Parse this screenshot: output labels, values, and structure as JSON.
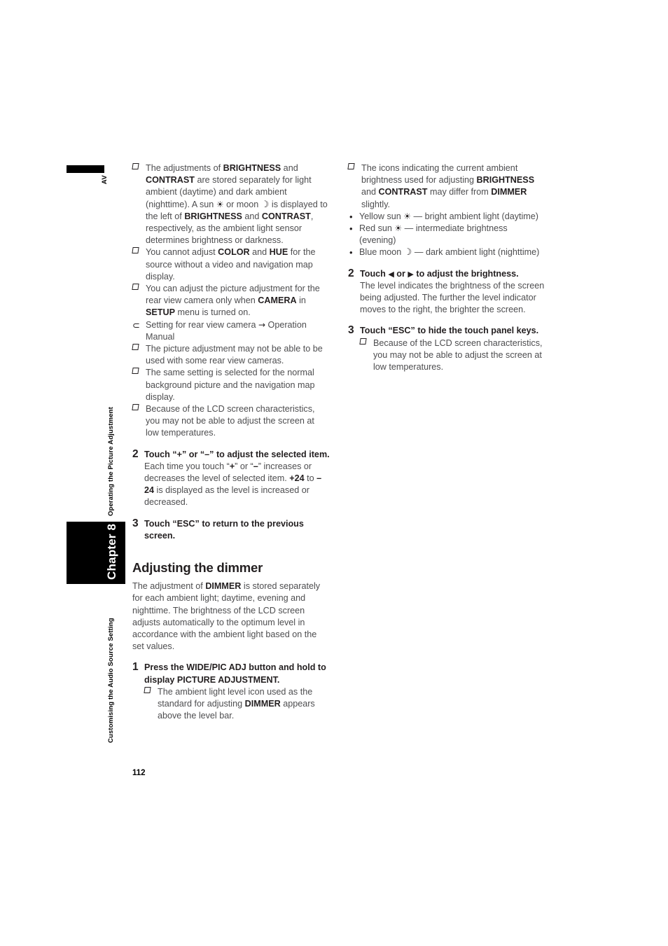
{
  "page": {
    "folio": "112",
    "margin_tab_label": "AV",
    "chapter_label": "Chapter 8",
    "running_head_upper": "Operating the Picture Adjustment",
    "running_head_lower": "Customising the Audio Source Setting"
  },
  "glyphs": {
    "square_bullet": "square-bullet-icon",
    "ref_arrow_bullet": "⊃",
    "dot_bullet": "•",
    "sun": "☀",
    "moon": "☽",
    "right_arrow": "→",
    "triangle_left": "◀",
    "triangle_right": "▶"
  },
  "left_column": {
    "notes_top": [
      {
        "marker": "square",
        "runs": [
          {
            "t": "The adjustments of ",
            "b": false
          },
          {
            "t": "BRIGHTNESS",
            "b": true
          },
          {
            "t": " and ",
            "b": false
          },
          {
            "t": "CONTRAST",
            "b": true
          },
          {
            "t": " are stored separately for light ambient (daytime) and dark ambient (nighttime). A sun ",
            "b": false
          },
          {
            "t": "☀",
            "g": "sun"
          },
          {
            "t": " or moon ",
            "b": false
          },
          {
            "t": "☽",
            "g": "moon"
          },
          {
            "t": " is displayed to the left of ",
            "b": false
          },
          {
            "t": "BRIGHTNESS",
            "b": true
          },
          {
            "t": " and ",
            "b": false
          },
          {
            "t": "CONTRAST",
            "b": true
          },
          {
            "t": ", respectively, as the ambient light sensor determines brightness or darkness.",
            "b": false
          }
        ]
      },
      {
        "marker": "square",
        "runs": [
          {
            "t": "You cannot adjust ",
            "b": false
          },
          {
            "t": "COLOR",
            "b": true
          },
          {
            "t": " and ",
            "b": false
          },
          {
            "t": "HUE",
            "b": true
          },
          {
            "t": " for the source without a video and navigation map display.",
            "b": false
          }
        ]
      },
      {
        "marker": "square",
        "runs": [
          {
            "t": "You can adjust the picture adjustment for the rear view camera only when ",
            "b": false
          },
          {
            "t": "CAMERA",
            "b": true
          },
          {
            "t": " in ",
            "b": false
          },
          {
            "t": "SETUP",
            "b": true
          },
          {
            "t": " menu is turned on.",
            "b": false
          }
        ]
      },
      {
        "marker": "ref",
        "runs": [
          {
            "t": "Setting for rear view camera ",
            "b": false
          },
          {
            "t": "→",
            "g": "arrow"
          },
          {
            "t": " Operation Manual",
            "b": false
          }
        ]
      },
      {
        "marker": "square",
        "runs": [
          {
            "t": "The picture adjustment may not be able to be used with some rear view cameras.",
            "b": false
          }
        ]
      },
      {
        "marker": "square",
        "runs": [
          {
            "t": "The same setting is selected for the normal background picture and the navigation map display.",
            "b": false
          }
        ]
      },
      {
        "marker": "square",
        "runs": [
          {
            "t": "Because of the LCD screen characteristics, you may not be able to adjust the screen at low temperatures.",
            "b": false
          }
        ]
      }
    ],
    "step2": {
      "number": "2",
      "title_runs": [
        {
          "t": "Touch “+” or “–” to adjust the selected item.",
          "b": true
        }
      ],
      "body_runs": [
        {
          "t": "Each time you touch “",
          "b": false
        },
        {
          "t": "+",
          "b": true
        },
        {
          "t": "” or “",
          "b": false
        },
        {
          "t": "–",
          "b": true
        },
        {
          "t": "” increases or decreases the level of selected item. ",
          "b": false
        },
        {
          "t": "+24",
          "b": true
        },
        {
          "t": " to ",
          "b": false
        },
        {
          "t": "–24",
          "b": true
        },
        {
          "t": " is displayed as the level is increased or decreased.",
          "b": false
        }
      ]
    },
    "step3": {
      "number": "3",
      "title_runs": [
        {
          "t": "Touch “ESC” to return to the previous screen.",
          "b": true
        }
      ]
    },
    "heading": "Adjusting the dimmer",
    "intro_runs": [
      {
        "t": "The adjustment of ",
        "b": false
      },
      {
        "t": "DIMMER",
        "b": true
      },
      {
        "t": " is stored separately for each ambient light; daytime, evening and nighttime. The brightness of the LCD screen adjusts automatically to the optimum level in accordance with the ambient light based on the set values.",
        "b": false
      }
    ],
    "step1": {
      "number": "1",
      "title_runs": [
        {
          "t": "Press the WIDE/PIC ADJ button and hold to display PICTURE ADJUSTMENT.",
          "b": true
        }
      ],
      "notes": [
        {
          "marker": "square",
          "runs": [
            {
              "t": "The ambient light level icon used as the standard for adjusting ",
              "b": false
            },
            {
              "t": "DIMMER",
              "b": true
            },
            {
              "t": " appears above the level bar.",
              "b": false
            }
          ]
        }
      ]
    }
  },
  "right_column": {
    "notes_top": [
      {
        "marker": "square",
        "runs": [
          {
            "t": "The icons indicating the current ambient brightness used for adjusting ",
            "b": false
          },
          {
            "t": "BRIGHTNESS",
            "b": true
          },
          {
            "t": " and ",
            "b": false
          },
          {
            "t": "CONTRAST",
            "b": true
          },
          {
            "t": " may differ from ",
            "b": false
          },
          {
            "t": "DIMMER",
            "b": true
          },
          {
            "t": " slightly.",
            "b": false
          }
        ]
      }
    ],
    "dot_items": [
      {
        "runs": [
          {
            "t": "Yellow sun ",
            "b": false
          },
          {
            "t": "☀",
            "g": "sun"
          },
          {
            "t": " — bright ambient light (daytime)",
            "b": false
          }
        ]
      },
      {
        "runs": [
          {
            "t": "Red sun ",
            "b": false
          },
          {
            "t": "☀",
            "g": "sun"
          },
          {
            "t": " — intermediate brightness (evening)",
            "b": false
          }
        ]
      },
      {
        "runs": [
          {
            "t": "Blue moon ",
            "b": false
          },
          {
            "t": "☽",
            "g": "moon"
          },
          {
            "t": " — dark ambient light (nighttime)",
            "b": false
          }
        ]
      }
    ],
    "step2": {
      "number": "2",
      "title_runs": [
        {
          "t": "Touch ",
          "b": true
        },
        {
          "t": "◀",
          "g": "tri"
        },
        {
          "t": " or ",
          "b": true
        },
        {
          "t": "▶",
          "g": "tri"
        },
        {
          "t": " to adjust the brightness.",
          "b": true
        }
      ],
      "body_runs": [
        {
          "t": "The level indicates the brightness of the screen being adjusted. The further the level indicator moves to the right, the brighter the screen.",
          "b": false
        }
      ]
    },
    "step3": {
      "number": "3",
      "title_runs": [
        {
          "t": "Touch “ESC” to hide the touch panel keys.",
          "b": true
        }
      ],
      "notes": [
        {
          "marker": "square",
          "runs": [
            {
              "t": "Because of the LCD screen characteristics, you may not be able to adjust the screen at low temperatures.",
              "b": false
            }
          ]
        }
      ]
    }
  }
}
